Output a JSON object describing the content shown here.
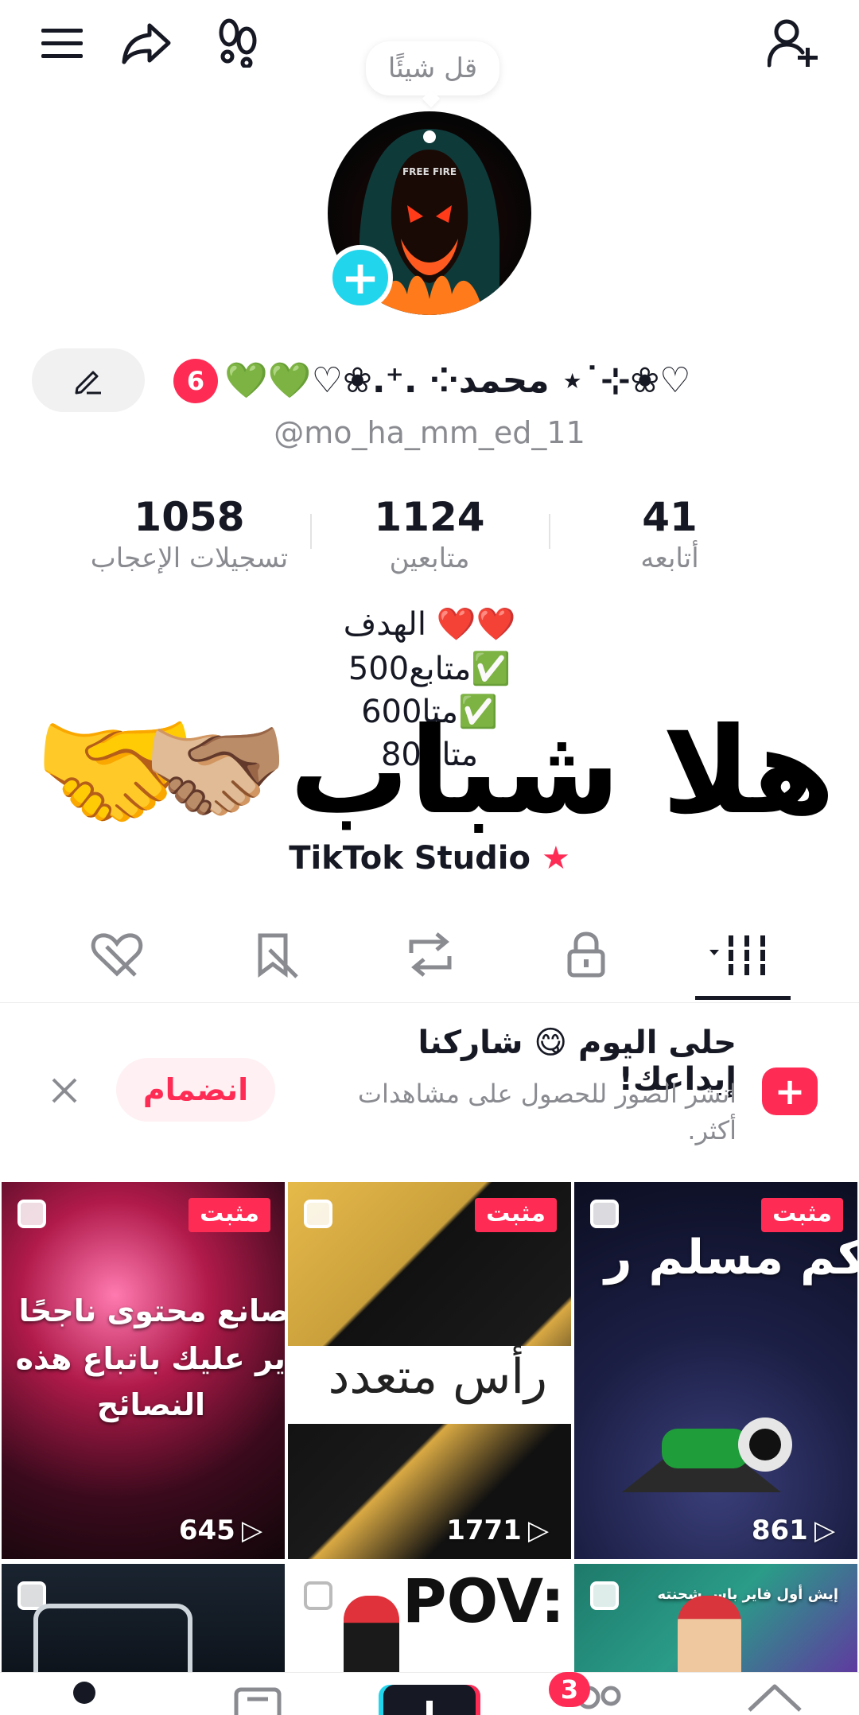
{
  "top_bar": {
    "menu_icon": "menu-icon",
    "share_icon": "share-icon",
    "footprints_icon": "footprints-icon",
    "add_friend_icon": "add-friend-icon",
    "note_placeholder": "قل شيئًا"
  },
  "profile": {
    "avatar_text": "FREE FIRE",
    "name": "♡❀⊹˙⋆ محمد⁘ .⁺.❀♡💚💚",
    "notification_count": "6",
    "handle": "@mo_ha_mm_ed_11"
  },
  "stats": [
    {
      "value": "41",
      "label": "أتابعه"
    },
    {
      "value": "1124",
      "label": "متابعين"
    },
    {
      "value": "1058",
      "label": "تسجيلات الإعجاب"
    }
  ],
  "bio": {
    "line1": "الهدف ❤️❤️",
    "line2": "500متابع✅",
    "line3": "600متا✅",
    "line4": "800متا",
    "overlay": "هلا شباب🫱🏼‍🫲🏽",
    "overlay_emoji": "🤝",
    "studio": "TikTok Studio"
  },
  "tabs": [
    "videos",
    "private",
    "reposts",
    "favorites",
    "liked"
  ],
  "banner": {
    "title": "حلى اليوم 😋 شاركنا إبداعك!",
    "subtitle": "انشر الصور للحصول على مشاهدات أكثر.",
    "join_label": "انضمام"
  },
  "grid": [
    {
      "pinned": "مثبت",
      "views": "645",
      "caption": [
        "صانع محتوى ناجحًا",
        "فاير عليك باتباع هذه",
        "النصائح"
      ]
    },
    {
      "pinned": "مثبت",
      "views": "1771",
      "caption": [
        "رأس متعدد"
      ]
    },
    {
      "pinned": "مثبت",
      "views": "861",
      "caption": [
        "كم مسلم ر"
      ]
    },
    {
      "caption": []
    },
    {
      "caption": [
        "POV:"
      ]
    },
    {
      "caption": [
        "إيش أول فاير باس شحنته"
      ]
    }
  ],
  "bottom_nav": {
    "friends_badge": "3"
  },
  "colors": {
    "accent": "#fe2c55",
    "cyan": "#20d5ec",
    "gray_text": "#8a8b91"
  }
}
